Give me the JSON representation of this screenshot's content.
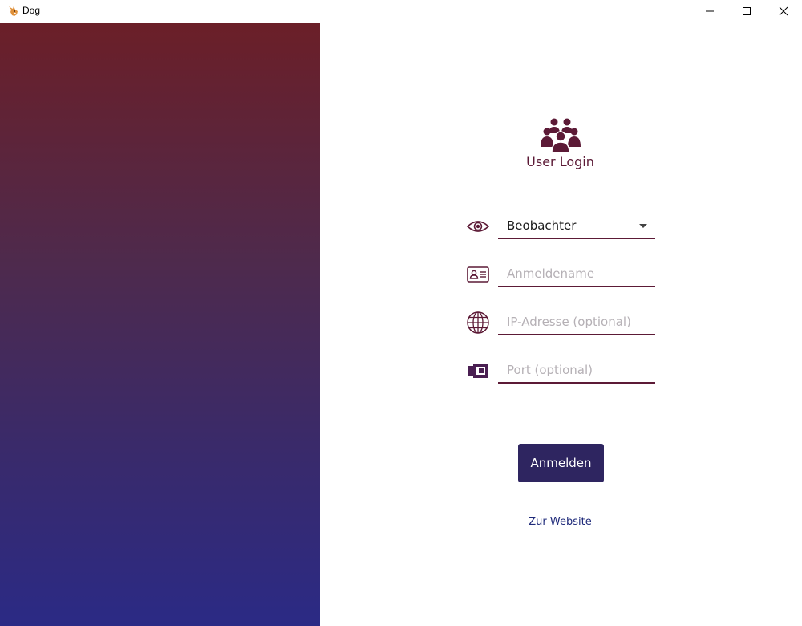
{
  "window": {
    "title": "Dog",
    "app_icon": "dog-icon",
    "controls": [
      "minimize-icon",
      "maximize-icon",
      "close-icon"
    ]
  },
  "login": {
    "header_icon": "users-group-icon",
    "title": "User Login",
    "fields": {
      "role": {
        "icon": "eye-icon",
        "value": "Beobachter",
        "type": "dropdown"
      },
      "username": {
        "icon": "id-card-icon",
        "placeholder": "Anmeldename",
        "value": ""
      },
      "ip": {
        "icon": "globe-icon",
        "placeholder": "IP-Adresse (optional)",
        "value": ""
      },
      "port": {
        "icon": "ethernet-port-icon",
        "placeholder": "Port (optional)",
        "value": ""
      }
    },
    "submit_label": "Anmelden",
    "website_link": "Zur Website"
  },
  "colors": {
    "accent": "#5c1a36",
    "button": "#2e2560",
    "gradient_top": "#6b1f28",
    "gradient_bottom": "#2b2a85",
    "link": "#1f2a7a"
  }
}
